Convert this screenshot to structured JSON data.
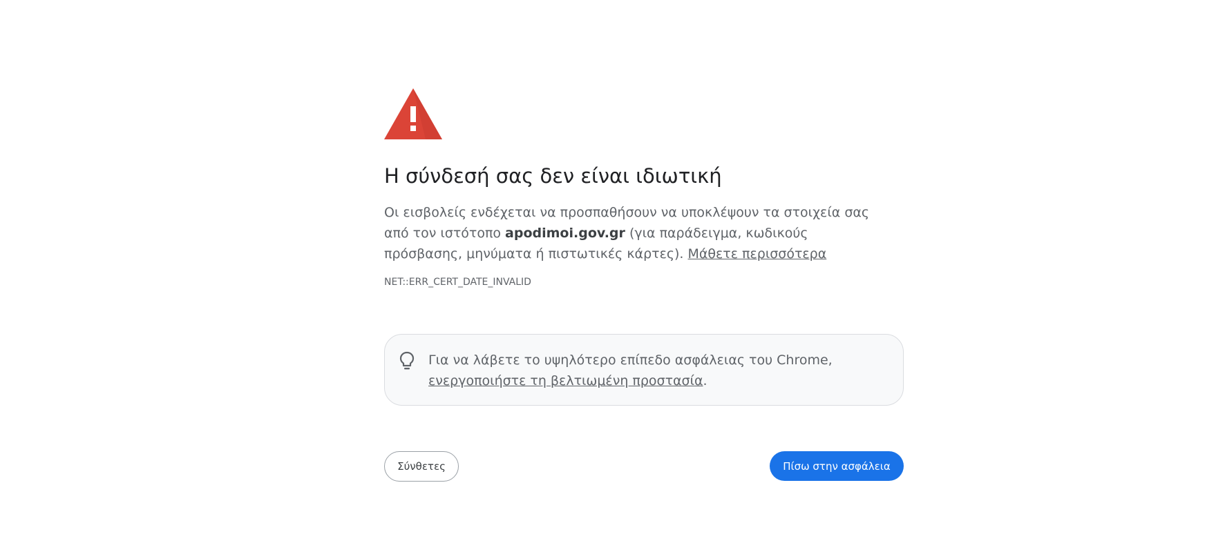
{
  "page": {
    "title": "Η σύνδεσή σας δεν είναι ιδιωτική",
    "description_prefix": "Οι εισβολείς ενδέχεται να προσπαθήσουν να υποκλέψουν τα στοιχεία σας από τον ιστότοπο ",
    "site_name": "apodimoi.gov.gr",
    "description_suffix": " (για παράδειγμα, κωδικούς πρόσβασης, μηνύματα ή πιστωτικές κάρτες). ",
    "learn_more_link": "Μάθετε περισσότερα",
    "error_code": "NET::ERR_CERT_DATE_INVALID"
  },
  "tip": {
    "icon": "lightbulb-icon",
    "text_prefix": "Για να λάβετε το υψηλότερο επίπεδο ασφάλειας του Chrome, ",
    "link_text": "ενεργοποιήστε τη βελτιωμένη προστασία",
    "text_suffix": "."
  },
  "buttons": {
    "advanced_label": "Σύνθετες",
    "back_label": "Πίσω στην ασφάλεια"
  },
  "colors": {
    "warning_red": "#db4437",
    "primary_blue": "#1a73e8",
    "text_gray": "#5f6368",
    "tip_background": "#f8f9fa"
  }
}
